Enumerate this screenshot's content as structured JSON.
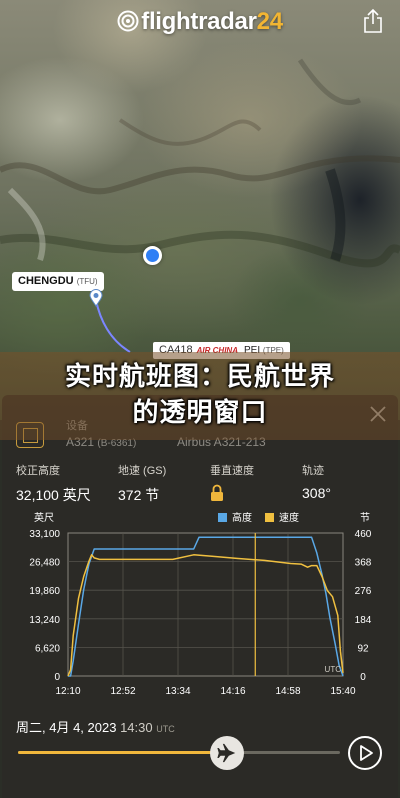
{
  "brand": {
    "name": "flightradar",
    "version": "24"
  },
  "map": {
    "origin_city": "CHENGDU",
    "origin_code": "(TFU)",
    "flight_number": "CA418",
    "airline": "AIR CHINA",
    "destination_partial": "PEI",
    "destination_code": "(TPE)"
  },
  "banner": {
    "line1": "实时航班图：民航世界",
    "line2": "的透明窗口"
  },
  "equipment": {
    "label": "设备",
    "code": "A321",
    "registration": "(B-6361)",
    "name": "Airbus A321-213"
  },
  "stats": [
    {
      "label": "校正高度",
      "value": "32,100 英尺"
    },
    {
      "label": "地速 (GS)",
      "value": "372 节"
    },
    {
      "label": "垂直速度",
      "value": ""
    },
    {
      "label": "轨迹",
      "value": "308°"
    }
  ],
  "chart_data": {
    "type": "line",
    "left_axis_unit": "英尺",
    "right_axis_unit": "节",
    "legend": [
      {
        "name": "高度",
        "color": "#5aa8e6"
      },
      {
        "name": "速度",
        "color": "#f0c040"
      }
    ],
    "left_ticks": [
      "33,100",
      "26,480",
      "19,860",
      "13,240",
      "6,620",
      "0"
    ],
    "right_ticks": [
      "460",
      "368",
      "276",
      "184",
      "92",
      "0"
    ],
    "x_ticks": [
      "12:10",
      "12:52",
      "13:34",
      "14:16",
      "14:58",
      "15:40"
    ],
    "x_minutes": [
      0,
      42,
      84,
      126,
      168,
      210
    ],
    "ylim_left": [
      0,
      33100
    ],
    "ylim_right": [
      0,
      460
    ],
    "corner_label": "UTC",
    "marker_minute": 143,
    "series": [
      {
        "name": "高度",
        "axis": "left",
        "x": [
          0,
          2,
          4,
          8,
          12,
          16,
          20,
          23,
          26,
          30,
          40,
          60,
          80,
          96,
          100,
          110,
          120,
          130,
          140,
          150,
          160,
          170,
          180,
          186,
          190,
          194,
          197,
          200,
          204,
          207,
          210
        ],
        "y": [
          0,
          0,
          3500,
          12000,
          20000,
          26000,
          29400,
          29400,
          29400,
          29400,
          29400,
          29400,
          29400,
          29400,
          32100,
          32100,
          32100,
          32100,
          32100,
          32100,
          32100,
          32100,
          32100,
          32100,
          28500,
          23500,
          19000,
          13500,
          7500,
          2500,
          0
        ]
      },
      {
        "name": "速度",
        "axis": "right",
        "x": [
          0,
          2,
          4,
          8,
          12,
          16,
          18,
          20,
          24,
          30,
          40,
          60,
          80,
          96,
          110,
          130,
          150,
          170,
          178,
          183,
          186,
          190,
          194,
          198,
          202,
          206,
          208,
          210
        ],
        "y": [
          0,
          20,
          130,
          250,
          320,
          370,
          390,
          380,
          375,
          375,
          375,
          375,
          375,
          390,
          385,
          378,
          372,
          362,
          360,
          350,
          355,
          355,
          320,
          275,
          255,
          195,
          80,
          10
        ]
      }
    ]
  },
  "footer": {
    "date": "周二, 4月 4, 2023",
    "time": "14:30",
    "tz": "UTC",
    "progress": 0.68
  },
  "colors": {
    "accent": "#f0b73c",
    "altitude": "#5aa8e6",
    "speed": "#f0c040",
    "pin": "#2f7ff5"
  }
}
